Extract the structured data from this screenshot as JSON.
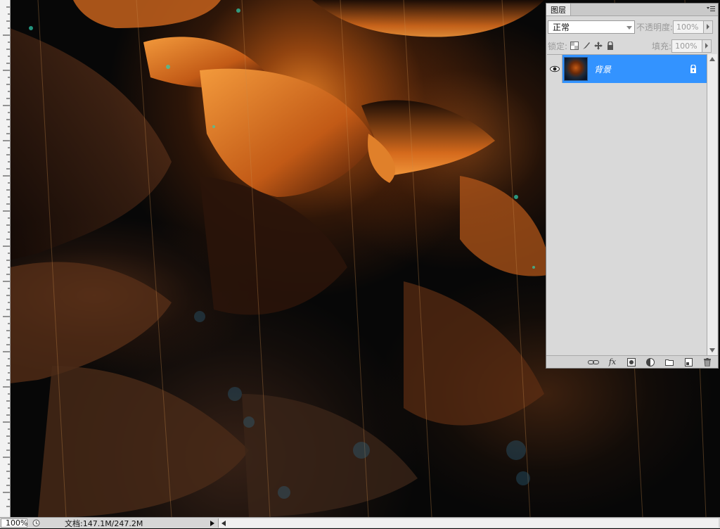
{
  "canvas": {
    "description_icon": "artwork-canvas"
  },
  "layers_panel": {
    "tab_label": "图层",
    "blend_mode": "正常",
    "opacity_label": "不透明度:",
    "opacity_value": "100%",
    "lock_label": "锁定:",
    "fill_label": "填充:",
    "fill_value": "100%",
    "layers": [
      {
        "name": "背景",
        "visible": true,
        "locked": true,
        "selected": true
      }
    ],
    "footer_icons": [
      "link-icon",
      "fx-icon",
      "mask-icon",
      "adjustment-icon",
      "group-folder-icon",
      "new-layer-icon",
      "trash-icon"
    ],
    "fx_text": "fx"
  },
  "statusbar": {
    "zoom": "100%",
    "doc_size": "文档:147.1M/247.2M"
  },
  "colors": {
    "selection": "#3393ff",
    "panel_bg": "#d9d9d9",
    "canvas_bg": "#070707",
    "petal_orange": "#e07a2a"
  }
}
